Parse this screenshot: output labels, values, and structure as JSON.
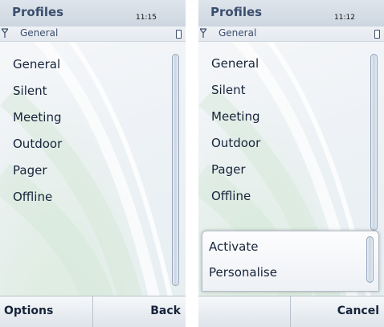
{
  "left_screen": {
    "title": "Profiles",
    "clock": "11:15",
    "status_profile": "General",
    "items": [
      "General",
      "Silent",
      "Meeting",
      "Outdoor",
      "Pager",
      "Offline"
    ],
    "softkey_left": "Options",
    "softkey_right": "Back"
  },
  "right_screen": {
    "title": "Profiles",
    "clock": "11:12",
    "status_profile": "General",
    "items": [
      "General",
      "Silent",
      "Meeting",
      "Outdoor",
      "Pager",
      "Offline"
    ],
    "popup_items": [
      "Activate",
      "Personalise"
    ],
    "softkey_left": "",
    "softkey_right": "Cancel"
  },
  "icons": {
    "signal": "antenna-signal-icon",
    "battery": "battery-icon"
  },
  "colors": {
    "title_text": "#3b4f6e",
    "list_text": "#16243a",
    "header_bg": "#cdd6e0"
  }
}
